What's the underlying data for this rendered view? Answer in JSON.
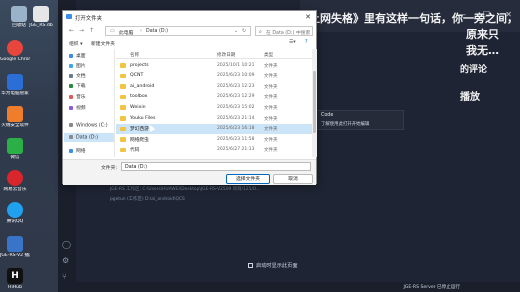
{
  "desktop": {
    "icons": [
      {
        "label": "回收站",
        "color": "#9bb3c8"
      },
      {
        "label": "JGE_RS.db",
        "color": "#e6e6e6"
      },
      {
        "label": "Google Chrome",
        "color": "#e8453c"
      },
      {
        "label": "华为电脑管家",
        "color": "#2b6fd6"
      },
      {
        "label": "火绒安全软件",
        "color": "#f07d2c"
      },
      {
        "label": "微信",
        "color": "#2bb048"
      },
      {
        "label": "网易云音乐",
        "color": "#d8262c"
      },
      {
        "label": "腾讯QQ",
        "color": "#20a0ef"
      },
      {
        "label": "JGE-RS-V2 播放1-25.7z",
        "color": "#3a74c8"
      },
      {
        "label": "HiHub",
        "color": "#111111"
      }
    ]
  },
  "editor": {
    "chinese_line1": "《上网失格》里有这样一句话，你一旁之间，",
    "chinese_line2": "原来只",
    "chinese_line3": "我无…",
    "chinese_line4": "的评论",
    "chinese_line5": "播放",
    "tooltip_title": "Code",
    "tooltip_text": "了解使用此打开开始编辑",
    "terminal_line1": "JGE-RS 工作区: C:\\Users\\HUAWEI\\Desktop\\JGE-RS-V2509 项目/125/O...",
    "terminal_line2": "pgetun (工作区)   D:\\ai_android\\QCS",
    "startup_label": "启动时显示此页面",
    "status_right": "JGE-RS Server 已停止运行"
  },
  "dialog": {
    "title": "打开文件夹",
    "close": "✕",
    "breadcrumb": [
      "此电脑",
      "Data (D:)"
    ],
    "search_placeholder": "在 Data (D:) 中搜索",
    "toolbar": {
      "organize": "组织 ▾",
      "new_folder": "新建文件夹"
    },
    "nav_items": [
      {
        "label": "桌面",
        "color": "#3a8ee6"
      },
      {
        "label": "图片",
        "color": "#3aa7e6"
      },
      {
        "label": "文档",
        "color": "#6b7a8f"
      },
      {
        "label": "下载",
        "color": "#2b8a3e"
      },
      {
        "label": "音乐",
        "color": "#e05a5a"
      },
      {
        "label": "视频",
        "color": "#8a5ad8"
      },
      {
        "label": "Windows (C:)",
        "color": "#8a8a8a"
      },
      {
        "label": "Data (D:)",
        "color": "#8a8a8a"
      },
      {
        "label": "网络",
        "color": "#3a8ee6"
      }
    ],
    "columns": {
      "name": "名称",
      "date": "修改日期",
      "type": "类型"
    },
    "files": [
      {
        "name": "projects",
        "date": "2025/10/1 10:21",
        "type": "文件夹"
      },
      {
        "name": "QCNT",
        "date": "2025/6/23 10:09",
        "type": "文件夹"
      },
      {
        "name": "ai_android",
        "date": "2025/6/23 12:23",
        "type": "文件夹"
      },
      {
        "name": "toolbox",
        "date": "2025/6/23 12:29",
        "type": "文件夹"
      },
      {
        "name": "Weixin",
        "date": "2025/6/23 15:02",
        "type": "文件夹"
      },
      {
        "name": "Youku Files",
        "date": "2025/6/23 21:14",
        "type": "文件夹"
      },
      {
        "name": "梦幻西游",
        "date": "2025/6/23 16:18",
        "type": "文件夹"
      },
      {
        "name": "网络爬虫",
        "date": "2025/6/23 11:58",
        "type": "文件夹"
      },
      {
        "name": "代码",
        "date": "2025/6/27 21:13",
        "type": "文件夹"
      }
    ],
    "highlighted_index": 6,
    "folder_label": "文件夹:",
    "folder_value": "Data (D:)",
    "select_button": "选择文件夹",
    "cancel_button": "取消"
  }
}
